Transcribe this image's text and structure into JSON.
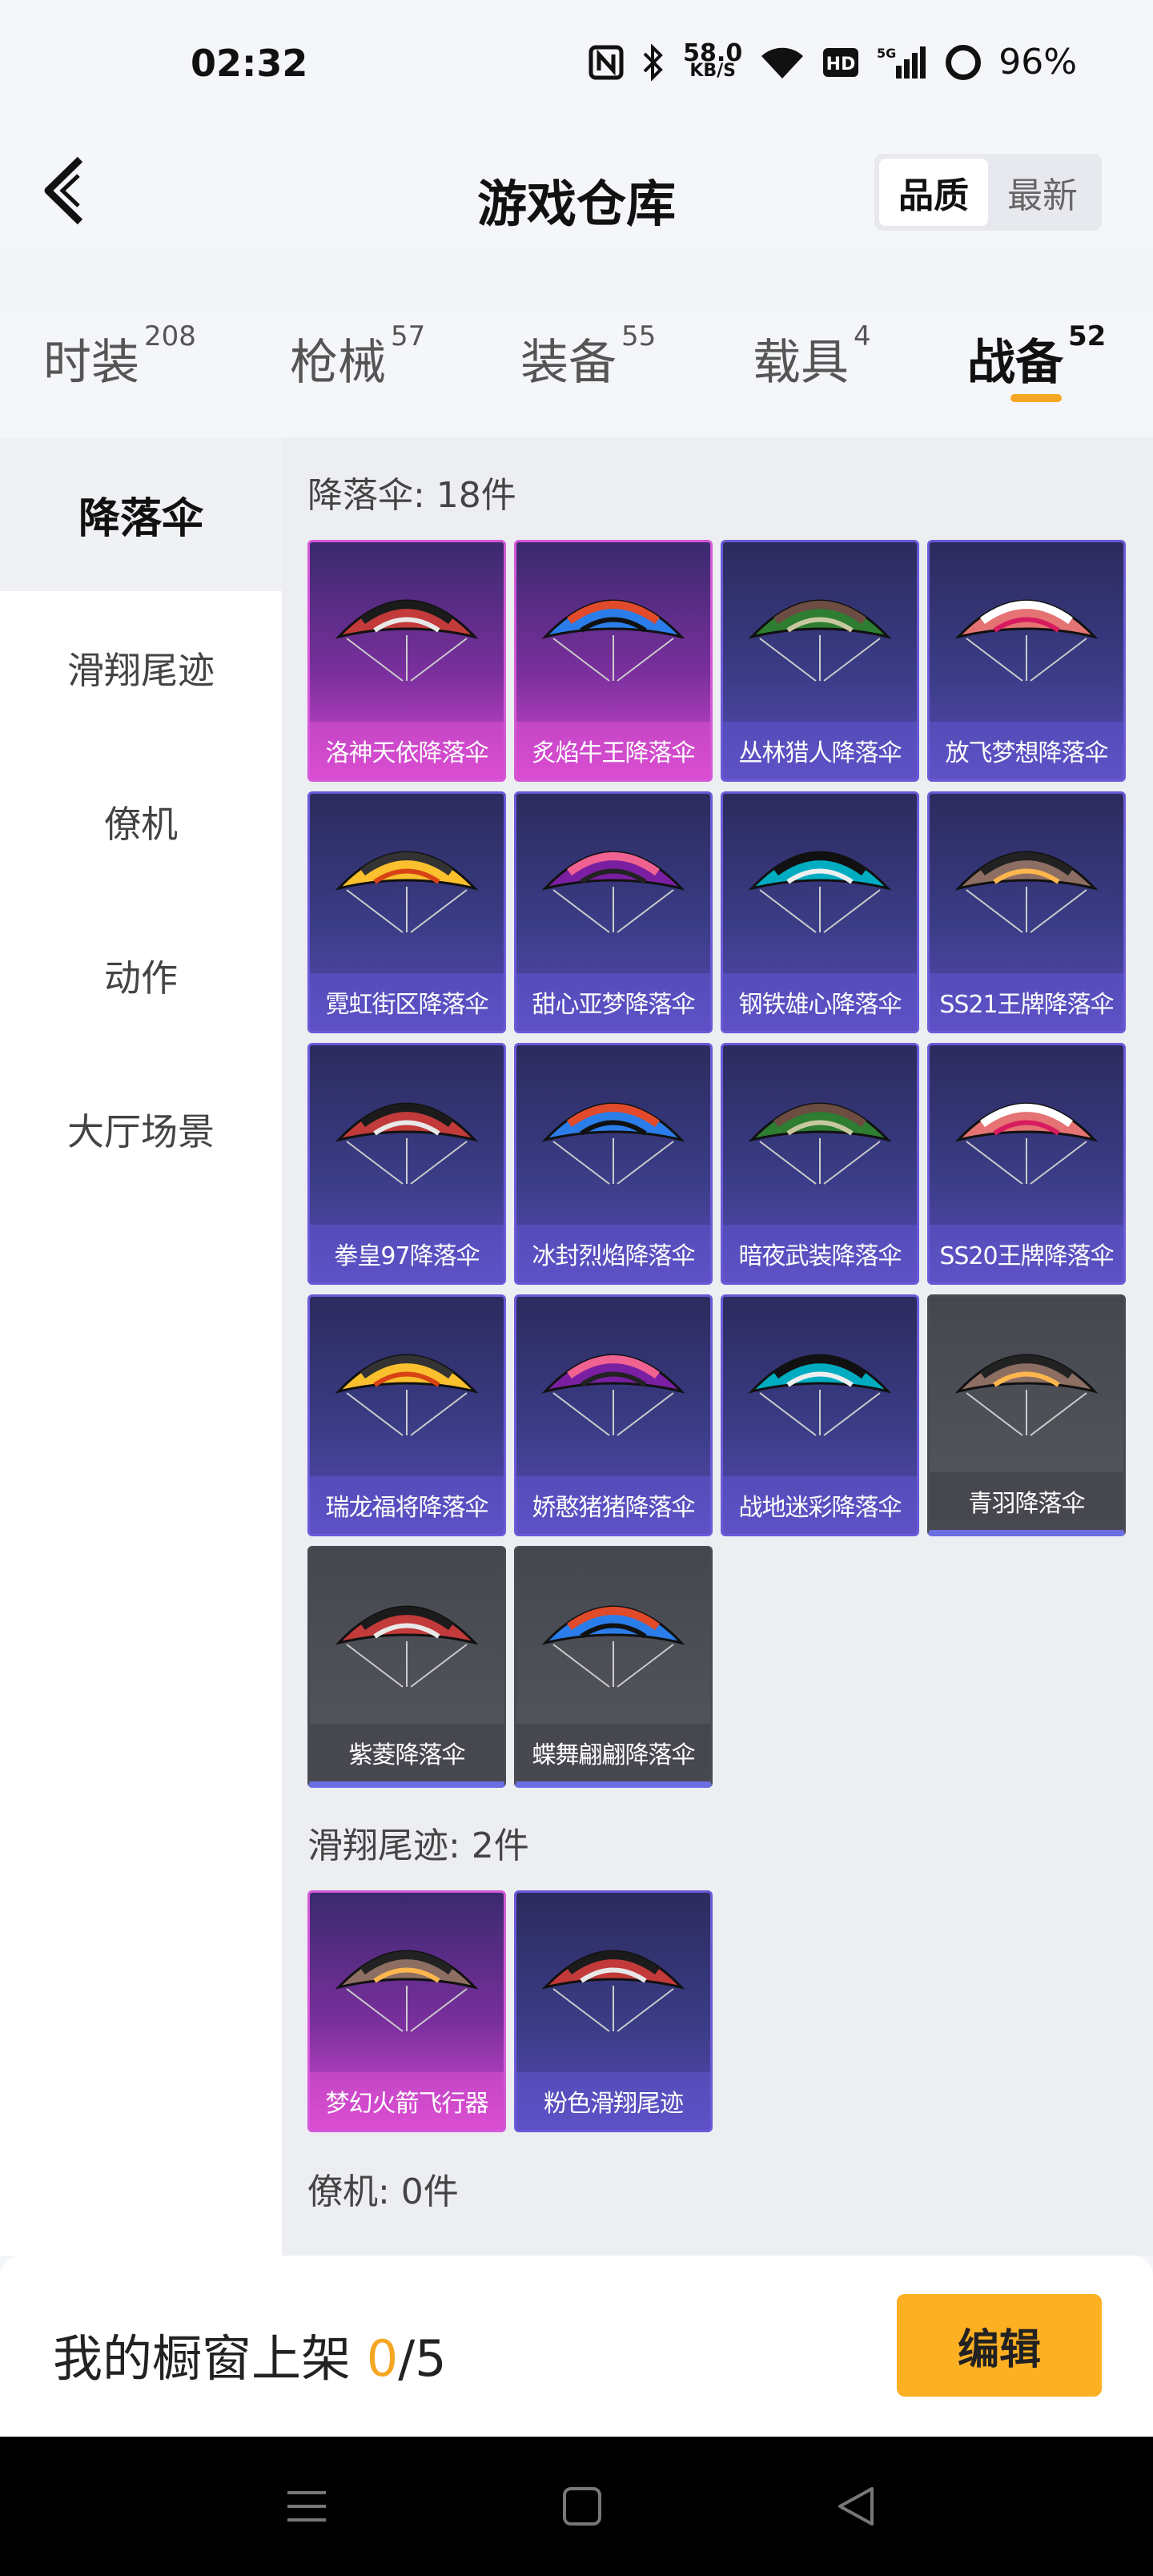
{
  "status_bar": {
    "time": "02:32",
    "net_speed_value": "58.0",
    "net_speed_unit": "KB/S",
    "battery": "96%",
    "icons": [
      "nfc-icon",
      "bluetooth-icon",
      "wifi-icon",
      "hd-icon",
      "5g-signal-icon",
      "battery-icon"
    ]
  },
  "header": {
    "title": "游戏仓库",
    "sort_options": [
      {
        "label": "品质",
        "active": true
      },
      {
        "label": "最新",
        "active": false
      }
    ]
  },
  "tabs": [
    {
      "label": "时装",
      "count": "208",
      "active": false
    },
    {
      "label": "枪械",
      "count": "57",
      "active": false
    },
    {
      "label": "装备",
      "count": "55",
      "active": false
    },
    {
      "label": "载具",
      "count": "4",
      "active": false
    },
    {
      "label": "战备",
      "count": "52",
      "active": true
    }
  ],
  "sidebar": {
    "items": [
      {
        "label": "降落伞",
        "active": true
      },
      {
        "label": "滑翔尾迹",
        "active": false
      },
      {
        "label": "僚机",
        "active": false
      },
      {
        "label": "动作",
        "active": false
      },
      {
        "label": "大厅场景",
        "active": false
      }
    ]
  },
  "sections": [
    {
      "title": "降落伞: 18件",
      "items": [
        {
          "name": "洛神天依降落伞",
          "rarity": "pink"
        },
        {
          "name": "炙焰牛王降落伞",
          "rarity": "pink"
        },
        {
          "name": "丛林猎人降落伞",
          "rarity": "purple"
        },
        {
          "name": "放飞梦想降落伞",
          "rarity": "purple"
        },
        {
          "name": "霓虹街区降落伞",
          "rarity": "purple"
        },
        {
          "name": "甜心亚梦降落伞",
          "rarity": "purple"
        },
        {
          "name": "钢铁雄心降落伞",
          "rarity": "purple"
        },
        {
          "name": "SS21王牌降落伞",
          "rarity": "purple"
        },
        {
          "name": "拳皇97降落伞",
          "rarity": "purple"
        },
        {
          "name": "冰封烈焰降落伞",
          "rarity": "purple"
        },
        {
          "name": "暗夜武装降落伞",
          "rarity": "purple"
        },
        {
          "name": "SS20王牌降落伞",
          "rarity": "purple"
        },
        {
          "name": "瑞龙福将降落伞",
          "rarity": "purple"
        },
        {
          "name": "娇憨猪猪降落伞",
          "rarity": "purple"
        },
        {
          "name": "战地迷彩降落伞",
          "rarity": "purple"
        },
        {
          "name": "青羽降落伞",
          "rarity": "grey"
        },
        {
          "name": "紫菱降落伞",
          "rarity": "grey"
        },
        {
          "name": "蝶舞翩翩降落伞",
          "rarity": "grey"
        }
      ]
    },
    {
      "title": "滑翔尾迹: 2件",
      "items": [
        {
          "name": "梦幻火箭飞行器",
          "rarity": "pink"
        },
        {
          "name": "粉色滑翔尾迹",
          "rarity": "purple"
        }
      ]
    },
    {
      "title": "僚机: 0件",
      "items": []
    }
  ],
  "showcase": {
    "label": "我的橱窗上架",
    "current": "0",
    "separator_total": "/5",
    "edit_label": "编辑"
  },
  "colors": {
    "accent": "#f5a623",
    "edit_button": "#fdb022",
    "rarity_pink": "#d458d8",
    "rarity_purple": "#6a5ad8",
    "rarity_grey": "#56575e"
  }
}
